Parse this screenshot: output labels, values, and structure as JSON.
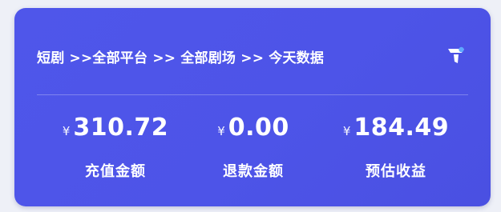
{
  "header": {
    "breadcrumb": "短剧 >>全部平台 >> 全部剧场 >> 今天数据",
    "filter_icon": "filter-icon"
  },
  "stats": [
    {
      "currency": "¥",
      "value": "310.72",
      "label": "充值金额"
    },
    {
      "currency": "¥",
      "value": "0.00",
      "label": "退款金额"
    },
    {
      "currency": "¥",
      "value": "184.49",
      "label": "预估收益"
    }
  ],
  "colors": {
    "card_background": "#4d54e8",
    "text": "#ffffff",
    "page_background": "#eef0f7"
  }
}
